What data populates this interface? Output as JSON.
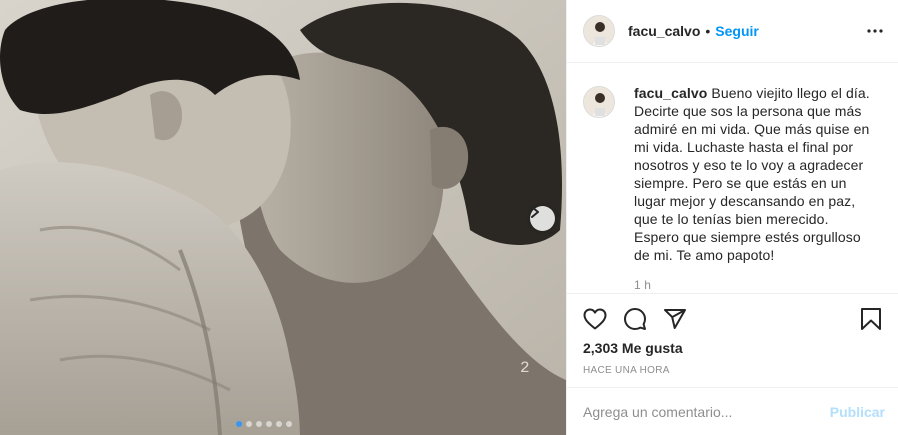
{
  "post": {
    "username": "facu_calvo",
    "separator": "•",
    "follow_label": "Seguir",
    "more_icon": "more-options-icon",
    "photo_stamp": "2",
    "carousel": {
      "slides": 6,
      "active_index": 0,
      "next_icon": "chevron-right-icon"
    }
  },
  "caption": {
    "username": "facu_calvo",
    "text": "Bueno viejito llego el día. Decirte que sos la persona que más admiré en mi vida. Que más quise en mi vida. Luchaste hasta el final por nosotros y eso te lo voy a agradecer siempre. Pero se que estás en un lugar mejor y descansando en paz, que te lo tenías bien merecido. Espero que siempre estés orgulloso de mi. Te amo papoto!",
    "time_ago": "1 h"
  },
  "actions": {
    "like_icon": "heart-icon",
    "comment_icon": "comment-icon",
    "share_icon": "share-icon",
    "save_icon": "bookmark-icon"
  },
  "likes_label": "2,303 Me gusta",
  "date_label": "HACE UNA HORA",
  "comment_box": {
    "placeholder": "Agrega un comentario...",
    "value": "",
    "publish_label": "Publicar"
  },
  "colors": {
    "link": "#0095f6",
    "publish_disabled": "#b2dffc",
    "muted": "#8e8e8e",
    "text": "#262626",
    "active_dot": "#3897f0"
  }
}
